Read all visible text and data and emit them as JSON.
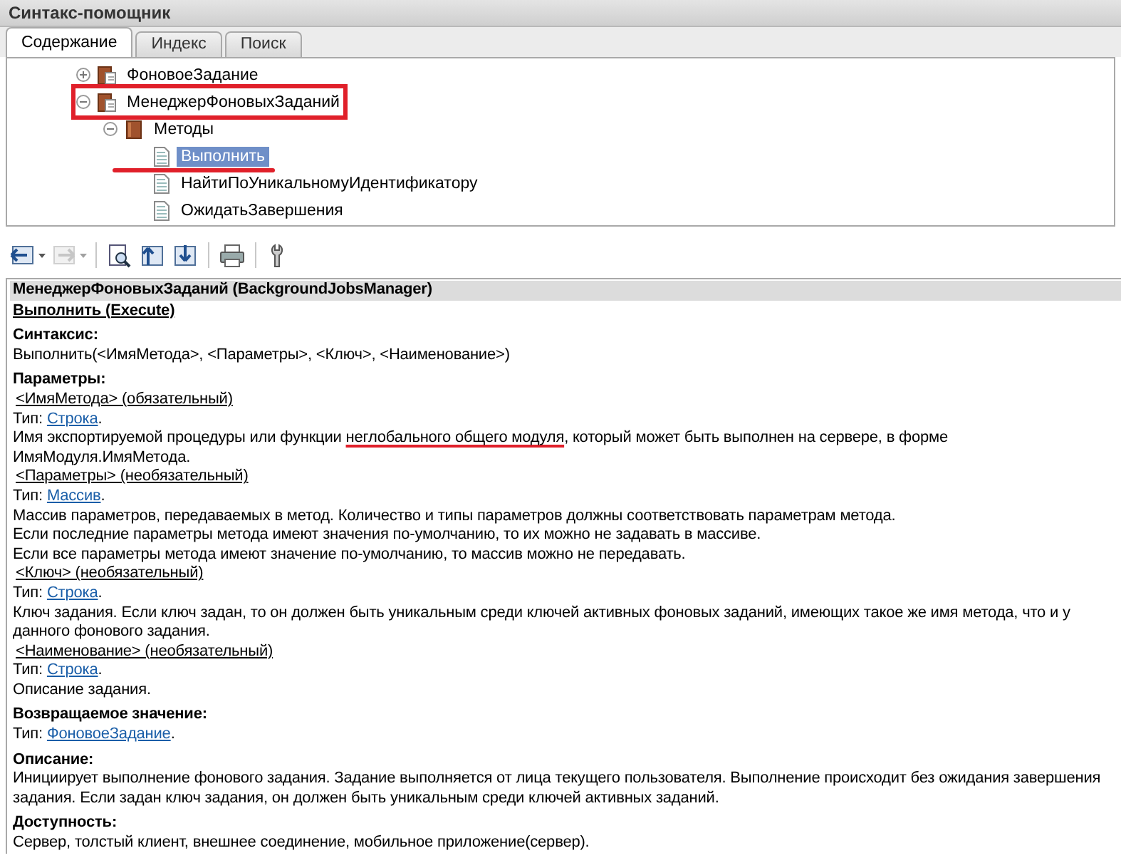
{
  "window": {
    "title": "Синтакс-помощник"
  },
  "tabs": [
    {
      "label": "Содержание",
      "selected": true
    },
    {
      "label": "Индекс",
      "selected": false
    },
    {
      "label": "Поиск",
      "selected": false
    }
  ],
  "tree": [
    {
      "label": "ФоновоеЗадание",
      "kind": "object",
      "expanded": false,
      "selected": false,
      "annotated": false
    },
    {
      "label": "МенеджерФоновыхЗаданий",
      "kind": "object",
      "expanded": true,
      "selected": false,
      "annotated": true,
      "children": [
        {
          "label": "Методы",
          "kind": "folder",
          "expanded": true,
          "selected": false,
          "annotated": false,
          "children": [
            {
              "label": "Выполнить",
              "kind": "page",
              "selected": true,
              "annotated": true
            },
            {
              "label": "НайтиПоУникальномуИдентификатору",
              "kind": "page",
              "selected": false,
              "annotated": false
            },
            {
              "label": "ОжидатьЗавершения",
              "kind": "page",
              "selected": false,
              "annotated": false
            }
          ]
        }
      ]
    }
  ],
  "toolbar": [
    {
      "buttons": [
        {
          "kind": "back",
          "disabled": false
        },
        {
          "kind": "forward",
          "disabled": true
        }
      ]
    },
    {
      "buttons": [
        {
          "kind": "find",
          "disabled": false
        },
        {
          "kind": "up",
          "disabled": false
        },
        {
          "kind": "sync",
          "disabled": false
        }
      ]
    },
    {
      "buttons": [
        {
          "kind": "print",
          "disabled": false
        }
      ]
    },
    {
      "buttons": [
        {
          "kind": "settings",
          "disabled": false
        }
      ]
    }
  ],
  "doc": {
    "header": "МенеджерФоновыхЗаданий (BackgroundJobsManager)",
    "method_title": "Выполнить (Execute)",
    "blocks": [
      {
        "kind": "heading",
        "text": "Синтаксис:"
      },
      {
        "kind": "text",
        "text": "Выполнить(<ИмяМетода>, <Параметры>, <Ключ>, <Наименование>)"
      },
      {
        "kind": "heading",
        "text": "Параметры:"
      },
      {
        "kind": "param",
        "text": "<ИмяМетода> (обязательный)"
      },
      {
        "kind": "type",
        "prefix": "Тип: ",
        "link": "Строка",
        "suffix": "."
      },
      {
        "kind": "text",
        "segments": [
          {
            "text": "Имя экспортируемой процедуры или функции ",
            "annotated": false
          },
          {
            "text": "неглобального общего модуля",
            "annotated": true
          },
          {
            "text": ", который может быть выполнен на сервере, в форме ИмяМодуля.ИмяМетода.",
            "annotated": false
          }
        ]
      },
      {
        "kind": "param",
        "text": "<Параметры> (необязательный)"
      },
      {
        "kind": "type",
        "prefix": "Тип: ",
        "link": "Массив",
        "suffix": "."
      },
      {
        "kind": "text",
        "text": "Массив параметров, передаваемых в метод. Количество и типы параметров должны соответствовать параметрам метода."
      },
      {
        "kind": "text",
        "text": "Если последние параметры метода имеют значения по-умолчанию, то их можно не задавать в массиве."
      },
      {
        "kind": "text",
        "text": "Если все параметры метода имеют значение по-умолчанию, то массив можно не передавать."
      },
      {
        "kind": "param",
        "text": "<Ключ> (необязательный)"
      },
      {
        "kind": "type",
        "prefix": "Тип: ",
        "link": "Строка",
        "suffix": "."
      },
      {
        "kind": "text",
        "text": "Ключ задания. Если ключ задан, то он должен быть уникальным среди ключей активных фоновых заданий, имеющих такое же имя метода, что и у данного фонового задания."
      },
      {
        "kind": "param",
        "text": "<Наименование> (необязательный)"
      },
      {
        "kind": "type",
        "prefix": "Тип: ",
        "link": "Строка",
        "suffix": "."
      },
      {
        "kind": "text",
        "text": "Описание задания."
      },
      {
        "kind": "heading",
        "text": "Возвращаемое значение:"
      },
      {
        "kind": "type",
        "prefix": "Тип: ",
        "link": "ФоновоеЗадание",
        "suffix": "."
      },
      {
        "kind": "heading",
        "text": "Описание:"
      },
      {
        "kind": "text",
        "text": "Инициирует выполнение фонового задания. Задание выполняется от лица текущего пользователя. Выполнение происходит без ожидания завершения задания. Если задан ключ задания, он должен быть уникальным среди ключей активных заданий."
      },
      {
        "kind": "heading",
        "text": "Доступность:"
      },
      {
        "kind": "text",
        "text": "Сервер, толстый клиент, внешнее соединение, мобильное приложение(сервер)."
      }
    ]
  }
}
